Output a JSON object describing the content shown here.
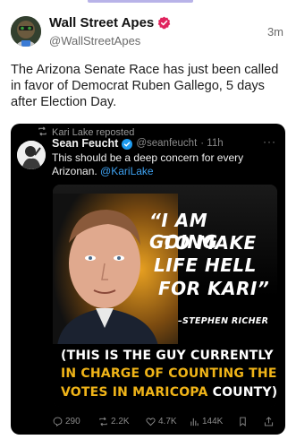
{
  "post": {
    "author_name": "Wall Street Apes",
    "author_handle": "@WallStreetApes",
    "time": "3m",
    "text": "The Arizona Senate Race has just been called in favor of Democrat Ruben Gallego, 5 days after Election Day."
  },
  "quote": {
    "repost_label": "Kari Lake reposted",
    "author_name": "Sean Feucht",
    "author_handle": "@seanfeucht",
    "time": "· 11h",
    "more": "···",
    "text": "This should be a deep concern for every Arizonan.",
    "mention": "@KariLake",
    "media": {
      "quote_lines": [
        "“I AM GOING",
        "TO MAKE",
        "LIFE HELL",
        "FOR KARI”"
      ],
      "attribution": "–STEPHEN RICHER",
      "caption_line1": "(THIS IS THE GUY CURRENTLY",
      "caption_line2": "IN CHARGE OF COUNTING THE",
      "caption_line3_yellow": "VOTES IN MARICOPA",
      "caption_line3_white": " COUNTY)"
    },
    "actions": {
      "replies": "290",
      "reposts": "2.2K",
      "likes": "4.7K",
      "views": "144K"
    }
  },
  "colors": {
    "verified_badge": "#e0245e",
    "mention": "#3ea1f0",
    "caption_yellow": "#f0b418",
    "card_bg": "#000000"
  },
  "icons": [
    "verified-badge-icon",
    "repost-icon",
    "reply-icon",
    "like-icon",
    "views-icon",
    "bookmark-icon",
    "share-icon"
  ]
}
